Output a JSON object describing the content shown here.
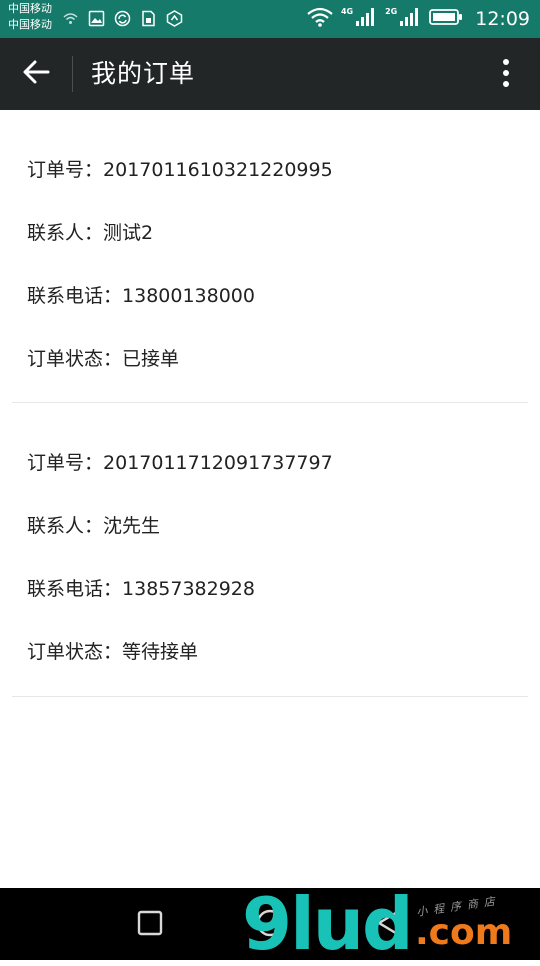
{
  "status_bar": {
    "carrier_1": "中国移动",
    "carrier_2": "中国移动",
    "net_4g": "4G",
    "net_2g": "2G",
    "time": "12:09"
  },
  "app_bar": {
    "title": "我的订单",
    "back_icon": "arrow-left-icon",
    "menu_icon": "more-vertical-icon"
  },
  "orders": [
    {
      "order_no_label": "订单号：",
      "order_no": "2017011610321220995",
      "contact_label": "联系人：",
      "contact": "测试2",
      "phone_label": "联系电话：",
      "phone": "13800138000",
      "status_label": "订单状态：",
      "status": "已接单"
    },
    {
      "order_no_label": "订单号：",
      "order_no": "2017011712091737797",
      "contact_label": "联系人：",
      "contact": "沈先生",
      "phone_label": "联系电话：",
      "phone": "13857382928",
      "status_label": "订单状态：",
      "status": "等待接单"
    }
  ],
  "watermark": {
    "brand_main": "9lud",
    "brand_tld": ".com",
    "brand_small": "小程序商店"
  },
  "colors": {
    "status_bar": "#167a6a",
    "app_bar": "#222626",
    "divider": "#e7e7e7",
    "brand_teal": "#19c2b6",
    "brand_orange": "#ee7a1c"
  }
}
